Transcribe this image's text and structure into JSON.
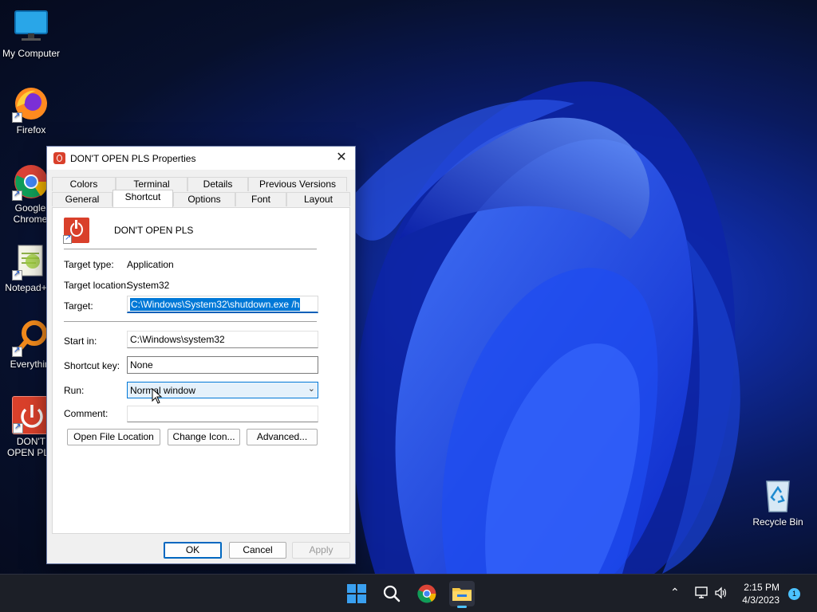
{
  "desktop": {
    "icons": [
      {
        "label": "My Computer",
        "icon": "monitor-icon"
      },
      {
        "label": "Firefox",
        "icon": "firefox-icon"
      },
      {
        "label": "Google Chrome",
        "icon": "chrome-icon"
      },
      {
        "label": "Notepad++",
        "icon": "notepadpp-icon"
      },
      {
        "label": "Everything",
        "icon": "everything-icon"
      },
      {
        "label": "DON'T OPEN PLS",
        "icon": "power-icon"
      },
      {
        "label": "Recycle Bin",
        "icon": "recycle-bin-icon"
      }
    ]
  },
  "dialog": {
    "title": "DON'T OPEN PLS Properties",
    "close_label": "✕",
    "tabs_row1": [
      "Colors",
      "Terminal",
      "Details",
      "Previous Versions"
    ],
    "tabs_row2": [
      "General",
      "Shortcut",
      "Options",
      "Font",
      "Layout"
    ],
    "active_tab": "Shortcut",
    "shortcut_name": "DON'T OPEN PLS",
    "fields": {
      "target_type_label": "Target type:",
      "target_type_value": "Application",
      "target_location_label": "Target location:",
      "target_location_value": "System32",
      "target_label": "Target:",
      "target_value": "C:\\Windows\\System32\\shutdown.exe /h",
      "start_in_label": "Start in:",
      "start_in_value": "C:\\Windows\\system32",
      "shortcut_key_label": "Shortcut key:",
      "shortcut_key_value": "None",
      "run_label": "Run:",
      "run_value": "Normal window",
      "comment_label": "Comment:",
      "comment_value": ""
    },
    "buttons": {
      "open_file_location": "Open File Location",
      "change_icon": "Change Icon...",
      "advanced": "Advanced...",
      "ok": "OK",
      "cancel": "Cancel",
      "apply": "Apply"
    }
  },
  "taskbar": {
    "time": "2:15 PM",
    "date": "4/3/2023",
    "notification_count": "1"
  }
}
